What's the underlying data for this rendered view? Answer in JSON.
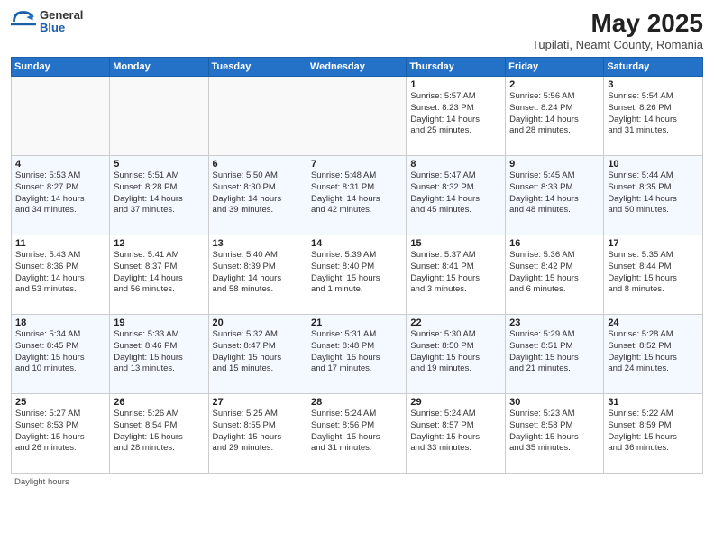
{
  "header": {
    "logo_general": "General",
    "logo_blue": "Blue",
    "month_title": "May 2025",
    "location": "Tupilati, Neamt County, Romania"
  },
  "days_of_week": [
    "Sunday",
    "Monday",
    "Tuesday",
    "Wednesday",
    "Thursday",
    "Friday",
    "Saturday"
  ],
  "weeks": [
    [
      {
        "day": "",
        "info": ""
      },
      {
        "day": "",
        "info": ""
      },
      {
        "day": "",
        "info": ""
      },
      {
        "day": "",
        "info": ""
      },
      {
        "day": "1",
        "info": "Sunrise: 5:57 AM\nSunset: 8:23 PM\nDaylight: 14 hours\nand 25 minutes."
      },
      {
        "day": "2",
        "info": "Sunrise: 5:56 AM\nSunset: 8:24 PM\nDaylight: 14 hours\nand 28 minutes."
      },
      {
        "day": "3",
        "info": "Sunrise: 5:54 AM\nSunset: 8:26 PM\nDaylight: 14 hours\nand 31 minutes."
      }
    ],
    [
      {
        "day": "4",
        "info": "Sunrise: 5:53 AM\nSunset: 8:27 PM\nDaylight: 14 hours\nand 34 minutes."
      },
      {
        "day": "5",
        "info": "Sunrise: 5:51 AM\nSunset: 8:28 PM\nDaylight: 14 hours\nand 37 minutes."
      },
      {
        "day": "6",
        "info": "Sunrise: 5:50 AM\nSunset: 8:30 PM\nDaylight: 14 hours\nand 39 minutes."
      },
      {
        "day": "7",
        "info": "Sunrise: 5:48 AM\nSunset: 8:31 PM\nDaylight: 14 hours\nand 42 minutes."
      },
      {
        "day": "8",
        "info": "Sunrise: 5:47 AM\nSunset: 8:32 PM\nDaylight: 14 hours\nand 45 minutes."
      },
      {
        "day": "9",
        "info": "Sunrise: 5:45 AM\nSunset: 8:33 PM\nDaylight: 14 hours\nand 48 minutes."
      },
      {
        "day": "10",
        "info": "Sunrise: 5:44 AM\nSunset: 8:35 PM\nDaylight: 14 hours\nand 50 minutes."
      }
    ],
    [
      {
        "day": "11",
        "info": "Sunrise: 5:43 AM\nSunset: 8:36 PM\nDaylight: 14 hours\nand 53 minutes."
      },
      {
        "day": "12",
        "info": "Sunrise: 5:41 AM\nSunset: 8:37 PM\nDaylight: 14 hours\nand 56 minutes."
      },
      {
        "day": "13",
        "info": "Sunrise: 5:40 AM\nSunset: 8:39 PM\nDaylight: 14 hours\nand 58 minutes."
      },
      {
        "day": "14",
        "info": "Sunrise: 5:39 AM\nSunset: 8:40 PM\nDaylight: 15 hours\nand 1 minute."
      },
      {
        "day": "15",
        "info": "Sunrise: 5:37 AM\nSunset: 8:41 PM\nDaylight: 15 hours\nand 3 minutes."
      },
      {
        "day": "16",
        "info": "Sunrise: 5:36 AM\nSunset: 8:42 PM\nDaylight: 15 hours\nand 6 minutes."
      },
      {
        "day": "17",
        "info": "Sunrise: 5:35 AM\nSunset: 8:44 PM\nDaylight: 15 hours\nand 8 minutes."
      }
    ],
    [
      {
        "day": "18",
        "info": "Sunrise: 5:34 AM\nSunset: 8:45 PM\nDaylight: 15 hours\nand 10 minutes."
      },
      {
        "day": "19",
        "info": "Sunrise: 5:33 AM\nSunset: 8:46 PM\nDaylight: 15 hours\nand 13 minutes."
      },
      {
        "day": "20",
        "info": "Sunrise: 5:32 AM\nSunset: 8:47 PM\nDaylight: 15 hours\nand 15 minutes."
      },
      {
        "day": "21",
        "info": "Sunrise: 5:31 AM\nSunset: 8:48 PM\nDaylight: 15 hours\nand 17 minutes."
      },
      {
        "day": "22",
        "info": "Sunrise: 5:30 AM\nSunset: 8:50 PM\nDaylight: 15 hours\nand 19 minutes."
      },
      {
        "day": "23",
        "info": "Sunrise: 5:29 AM\nSunset: 8:51 PM\nDaylight: 15 hours\nand 21 minutes."
      },
      {
        "day": "24",
        "info": "Sunrise: 5:28 AM\nSunset: 8:52 PM\nDaylight: 15 hours\nand 24 minutes."
      }
    ],
    [
      {
        "day": "25",
        "info": "Sunrise: 5:27 AM\nSunset: 8:53 PM\nDaylight: 15 hours\nand 26 minutes."
      },
      {
        "day": "26",
        "info": "Sunrise: 5:26 AM\nSunset: 8:54 PM\nDaylight: 15 hours\nand 28 minutes."
      },
      {
        "day": "27",
        "info": "Sunrise: 5:25 AM\nSunset: 8:55 PM\nDaylight: 15 hours\nand 29 minutes."
      },
      {
        "day": "28",
        "info": "Sunrise: 5:24 AM\nSunset: 8:56 PM\nDaylight: 15 hours\nand 31 minutes."
      },
      {
        "day": "29",
        "info": "Sunrise: 5:24 AM\nSunset: 8:57 PM\nDaylight: 15 hours\nand 33 minutes."
      },
      {
        "day": "30",
        "info": "Sunrise: 5:23 AM\nSunset: 8:58 PM\nDaylight: 15 hours\nand 35 minutes."
      },
      {
        "day": "31",
        "info": "Sunrise: 5:22 AM\nSunset: 8:59 PM\nDaylight: 15 hours\nand 36 minutes."
      }
    ]
  ],
  "footer": {
    "daylight_label": "Daylight hours"
  }
}
